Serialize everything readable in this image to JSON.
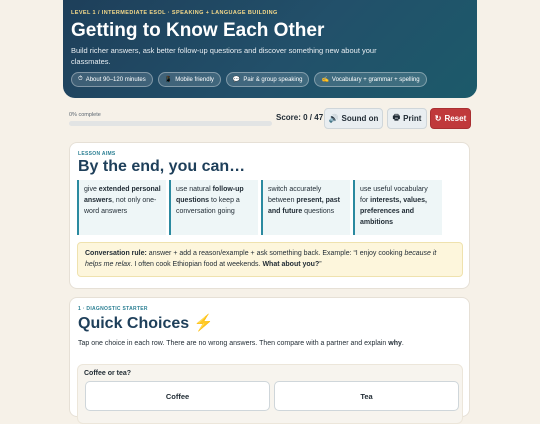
{
  "hero": {
    "eyebrow": "LEVEL 1 / INTERMEDIATE ESOL · SPEAKING + LANGUAGE BUILDING",
    "title": "Getting to Know Each Other",
    "subtitle": "Build richer answers, ask better follow-up questions and discover something new about your classmates.",
    "chips": [
      {
        "icon": "⏱",
        "icon_name": "stopwatch-icon",
        "label": "About 90–120 minutes"
      },
      {
        "icon": "📱",
        "icon_name": "mobile-icon",
        "label": "Mobile friendly"
      },
      {
        "icon": "💬",
        "icon_name": "speech-bubble-icon",
        "label": "Pair & group speaking"
      },
      {
        "icon": "✍",
        "icon_name": "writing-hand-icon",
        "label": "Vocabulary + grammar + spelling"
      }
    ]
  },
  "progress": {
    "label": "0% complete",
    "value": 0
  },
  "score": {
    "text": "Score: 0 / 47"
  },
  "toolbar": {
    "sound_icon": "🔊",
    "sound_label": "Sound on",
    "print_icon": "🖶",
    "print_label": "Print",
    "reset_icon": "↻",
    "reset_label": "Reset"
  },
  "aims": {
    "kicker": "LESSON AIMS",
    "title": "By the end, you can…",
    "items": [
      {
        "pre": "give ",
        "bold": "extended personal answers",
        "post": ", not only one-word answers"
      },
      {
        "pre": "use natural ",
        "bold": "follow-up questions",
        "post": " to keep a conversation going"
      },
      {
        "pre": "switch accurately between ",
        "bold": "present, past and future",
        "post": " questions"
      },
      {
        "pre": "use useful vocabulary for ",
        "bold": "interests, values, preferences and ambitions",
        "post": ""
      }
    ],
    "rule_label": "Conversation rule:",
    "rule_text1": " answer + add a reason/example + ask something back. Example: “I enjoy cooking ",
    "rule_italic": "because it helps me relax",
    "rule_text2": ". I often cook Ethiopian food at weekends. ",
    "rule_bold_end": "What about you?",
    "rule_close": "”"
  },
  "diagnostic": {
    "kicker": "1 · DIAGNOSTIC STARTER",
    "title": "Quick Choices",
    "title_icon": "⚡",
    "instr_text": "Tap one choice in each row. There are no wrong answers. Then compare with a partner and explain ",
    "instr_bold": "why",
    "instr_end": ".",
    "rows": [
      {
        "question": "Coffee or tea?",
        "option_a": "Coffee",
        "option_b": "Tea"
      }
    ]
  },
  "colors": {
    "accent": "#2b8aa0",
    "hero_bg": "#1e3f5a",
    "reset": "#c0393b",
    "eyebrow": "#f4d98a"
  }
}
